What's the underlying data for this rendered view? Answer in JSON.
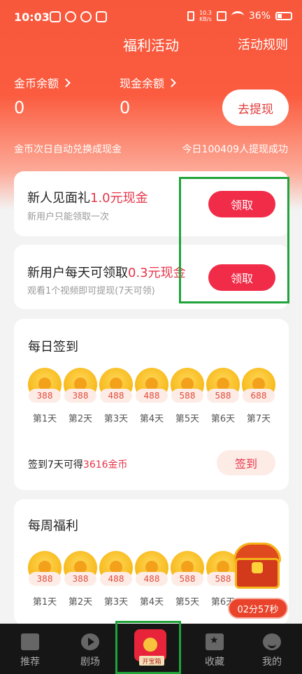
{
  "status_bar": {
    "time": "10:03",
    "net_speed_value": "10.3",
    "net_speed_unit": "KB/s",
    "battery": "36%"
  },
  "header": {
    "title": "福利活动",
    "rules_link": "活动规则"
  },
  "balances": {
    "coin_label": "金币余额",
    "coin_value": "0",
    "cash_label": "现金余额",
    "cash_value": "0",
    "withdraw_button": "去提现",
    "auto_exchange_note": "金币次日自动兑换成现金",
    "today_withdraw_note": "今日100409人提现成功"
  },
  "tasks": [
    {
      "title_prefix": "新人见面礼",
      "title_amount": "1.0元现金",
      "subtitle": "新用户只能领取一次",
      "button": "领取"
    },
    {
      "title_prefix": "新用户每天可领取",
      "title_amount": "0.3元现金",
      "subtitle": "观看1个视频即可提现(7天可领)",
      "button": "领取"
    }
  ],
  "daily_signin": {
    "title": "每日签到",
    "days": [
      {
        "value": "388",
        "label": "第1天"
      },
      {
        "value": "388",
        "label": "第2天"
      },
      {
        "value": "488",
        "label": "第3天"
      },
      {
        "value": "488",
        "label": "第4天"
      },
      {
        "value": "588",
        "label": "第5天"
      },
      {
        "value": "588",
        "label": "第6天"
      },
      {
        "value": "688",
        "label": "第7天"
      }
    ],
    "note_prefix": "签到7天可得",
    "note_amount": "3616金币",
    "button": "签到"
  },
  "weekly_bonus": {
    "title": "每周福利",
    "days": [
      {
        "value": "388",
        "label": "第1天"
      },
      {
        "value": "388",
        "label": "第2天"
      },
      {
        "value": "488",
        "label": "第3天"
      },
      {
        "value": "488",
        "label": "第4天"
      },
      {
        "value": "588",
        "label": "第5天"
      },
      {
        "value": "588",
        "label": "第6天"
      }
    ]
  },
  "treasure_float": {
    "timer": "02分57秒"
  },
  "tab_bar": {
    "items": [
      {
        "label": "推荐"
      },
      {
        "label": "剧场"
      },
      {
        "label": "开宝箱"
      },
      {
        "label": "收藏"
      },
      {
        "label": "我的"
      }
    ]
  },
  "colors": {
    "accent": "#f12c48",
    "hero_top": "#f7573b",
    "highlight_box": "#20a33a"
  }
}
